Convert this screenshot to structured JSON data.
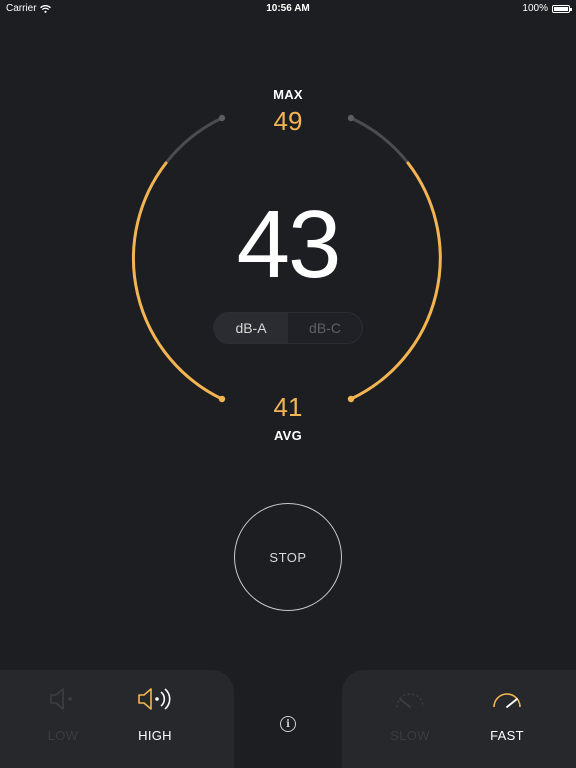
{
  "status_bar": {
    "carrier": "Carrier",
    "time": "10:56 AM",
    "battery": "100%",
    "battery_level": 1.0
  },
  "meter": {
    "max_label": "MAX",
    "max_value": "49",
    "reading": "43",
    "avg_value": "41",
    "avg_label": "AVG",
    "weighting": {
      "options": [
        "dB-A",
        "dB-C"
      ],
      "selected": "dB-A"
    },
    "stop_label": "STOP"
  },
  "sensitivity": {
    "low_label": "LOW",
    "high_label": "HIGH",
    "selected": "HIGH"
  },
  "response": {
    "slow_label": "SLOW",
    "fast_label": "FAST",
    "selected": "FAST"
  },
  "info_label": "i",
  "colors": {
    "accent": "#f3b552",
    "background": "#1d1e22",
    "panel": "#26282c",
    "track": "#4a4c52"
  },
  "icons": {
    "sensitivity_low": "speaker-low-icon",
    "sensitivity_high": "speaker-high-icon",
    "response_slow": "gauge-slow-icon",
    "response_fast": "gauge-fast-icon",
    "info": "info-icon",
    "wifi": "wifi-icon",
    "battery": "battery-icon"
  }
}
